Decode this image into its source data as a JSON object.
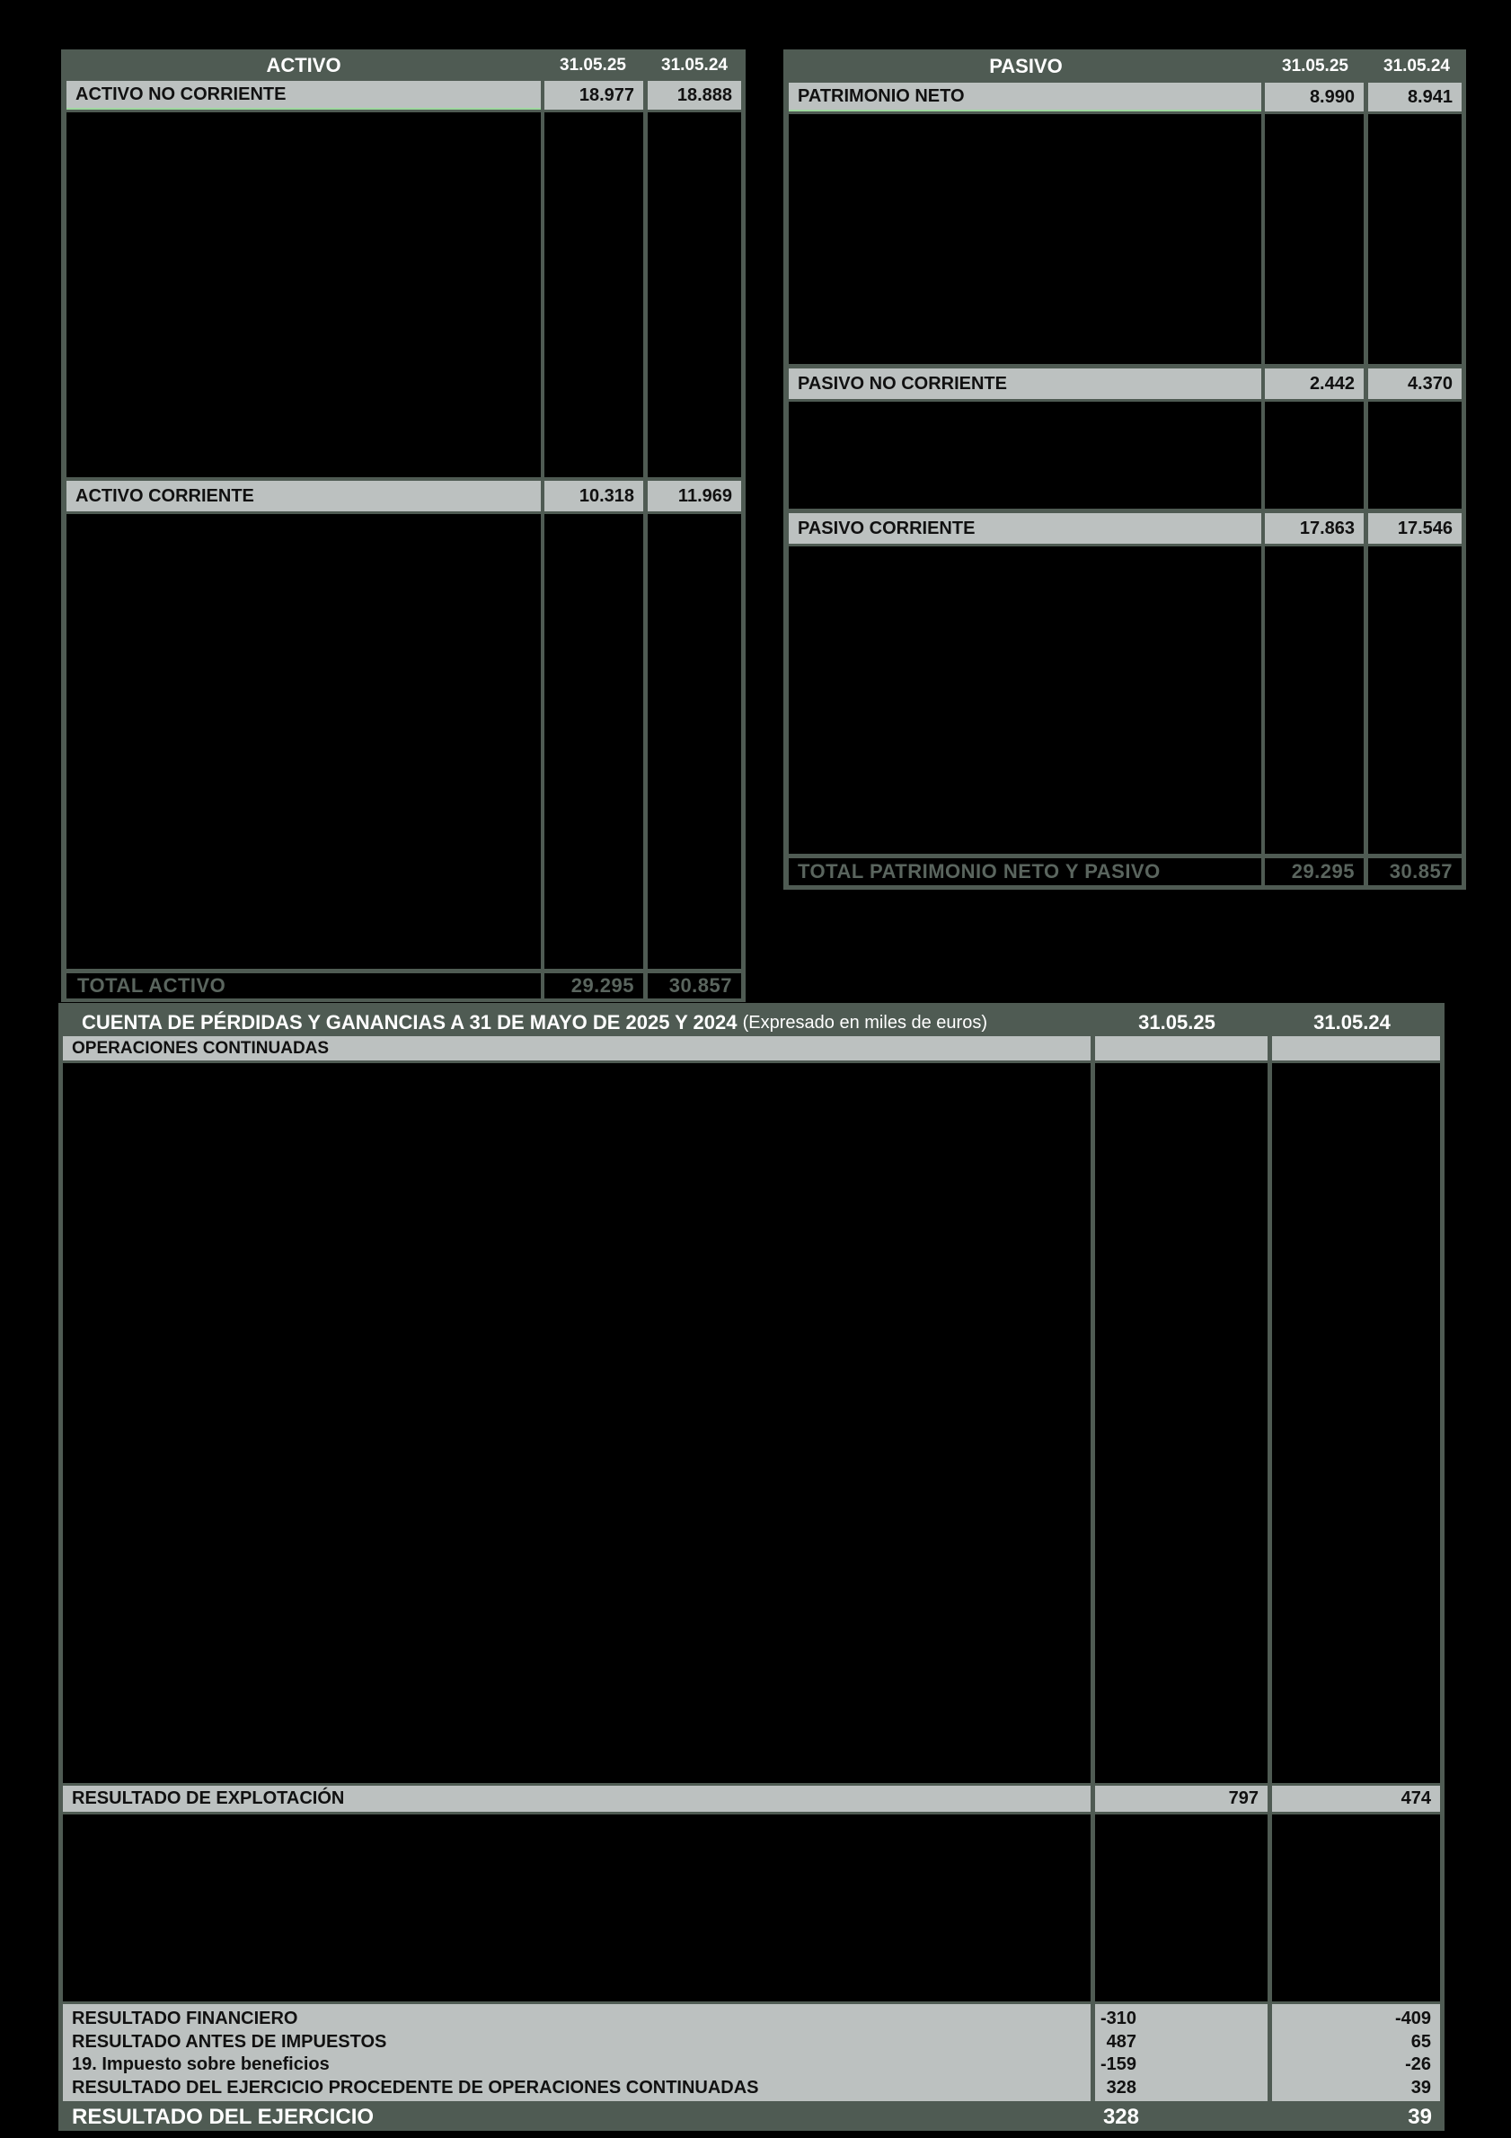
{
  "activo": {
    "header": "ACTIVO",
    "col1": "31.05.25",
    "col2": "31.05.24",
    "no_corriente": {
      "label": "ACTIVO NO CORRIENTE",
      "v1": "18.977",
      "v2": "18.888"
    },
    "corriente": {
      "label": "ACTIVO CORRIENTE",
      "v1": "10.318",
      "v2": "11.969"
    },
    "total": {
      "label": "TOTAL ACTIVO",
      "v1": "29.295",
      "v2": "30.857"
    }
  },
  "pasivo": {
    "header": "PASIVO",
    "col1": "31.05.25",
    "col2": "31.05.24",
    "patrimonio": {
      "label": "PATRIMONIO NETO",
      "v1": "8.990",
      "v2": "8.941"
    },
    "no_corriente": {
      "label": "PASIVO NO CORRIENTE",
      "v1": "2.442",
      "v2": "4.370"
    },
    "corriente": {
      "label": "PASIVO CORRIENTE",
      "v1": "17.863",
      "v2": "17.546"
    },
    "total": {
      "label": "TOTAL PATRIMONIO NETO Y PASIVO",
      "v1": "29.295",
      "v2": "30.857"
    }
  },
  "pyg": {
    "title": "CUENTA DE PÉRDIDAS Y GANANCIAS A 31 DE MAYO DE 2025 Y 2024",
    "subtitle": "(Expresado en miles de euros)",
    "col1": "31.05.25",
    "col2": "31.05.24",
    "operaciones": "OPERACIONES CONTINUADAS",
    "explotacion": {
      "label": "RESULTADO DE EXPLOTACIÓN",
      "v1": "797",
      "v2": "474"
    },
    "rows": [
      {
        "label": "RESULTADO FINANCIERO",
        "v1": "-310",
        "v2": "-409"
      },
      {
        "label": "RESULTADO ANTES DE IMPUESTOS",
        "v1": "487",
        "v2": "65"
      },
      {
        "label": "19. Impuesto sobre beneficios",
        "v1": "-159",
        "v2": "-26"
      },
      {
        "label": "RESULTADO DEL EJERCICIO PROCEDENTE DE OPERACIONES CONTINUADAS",
        "v1": "328",
        "v2": "39"
      }
    ],
    "final": {
      "label": "RESULTADO DEL EJERCICIO",
      "v1": "328",
      "v2": "39"
    }
  }
}
